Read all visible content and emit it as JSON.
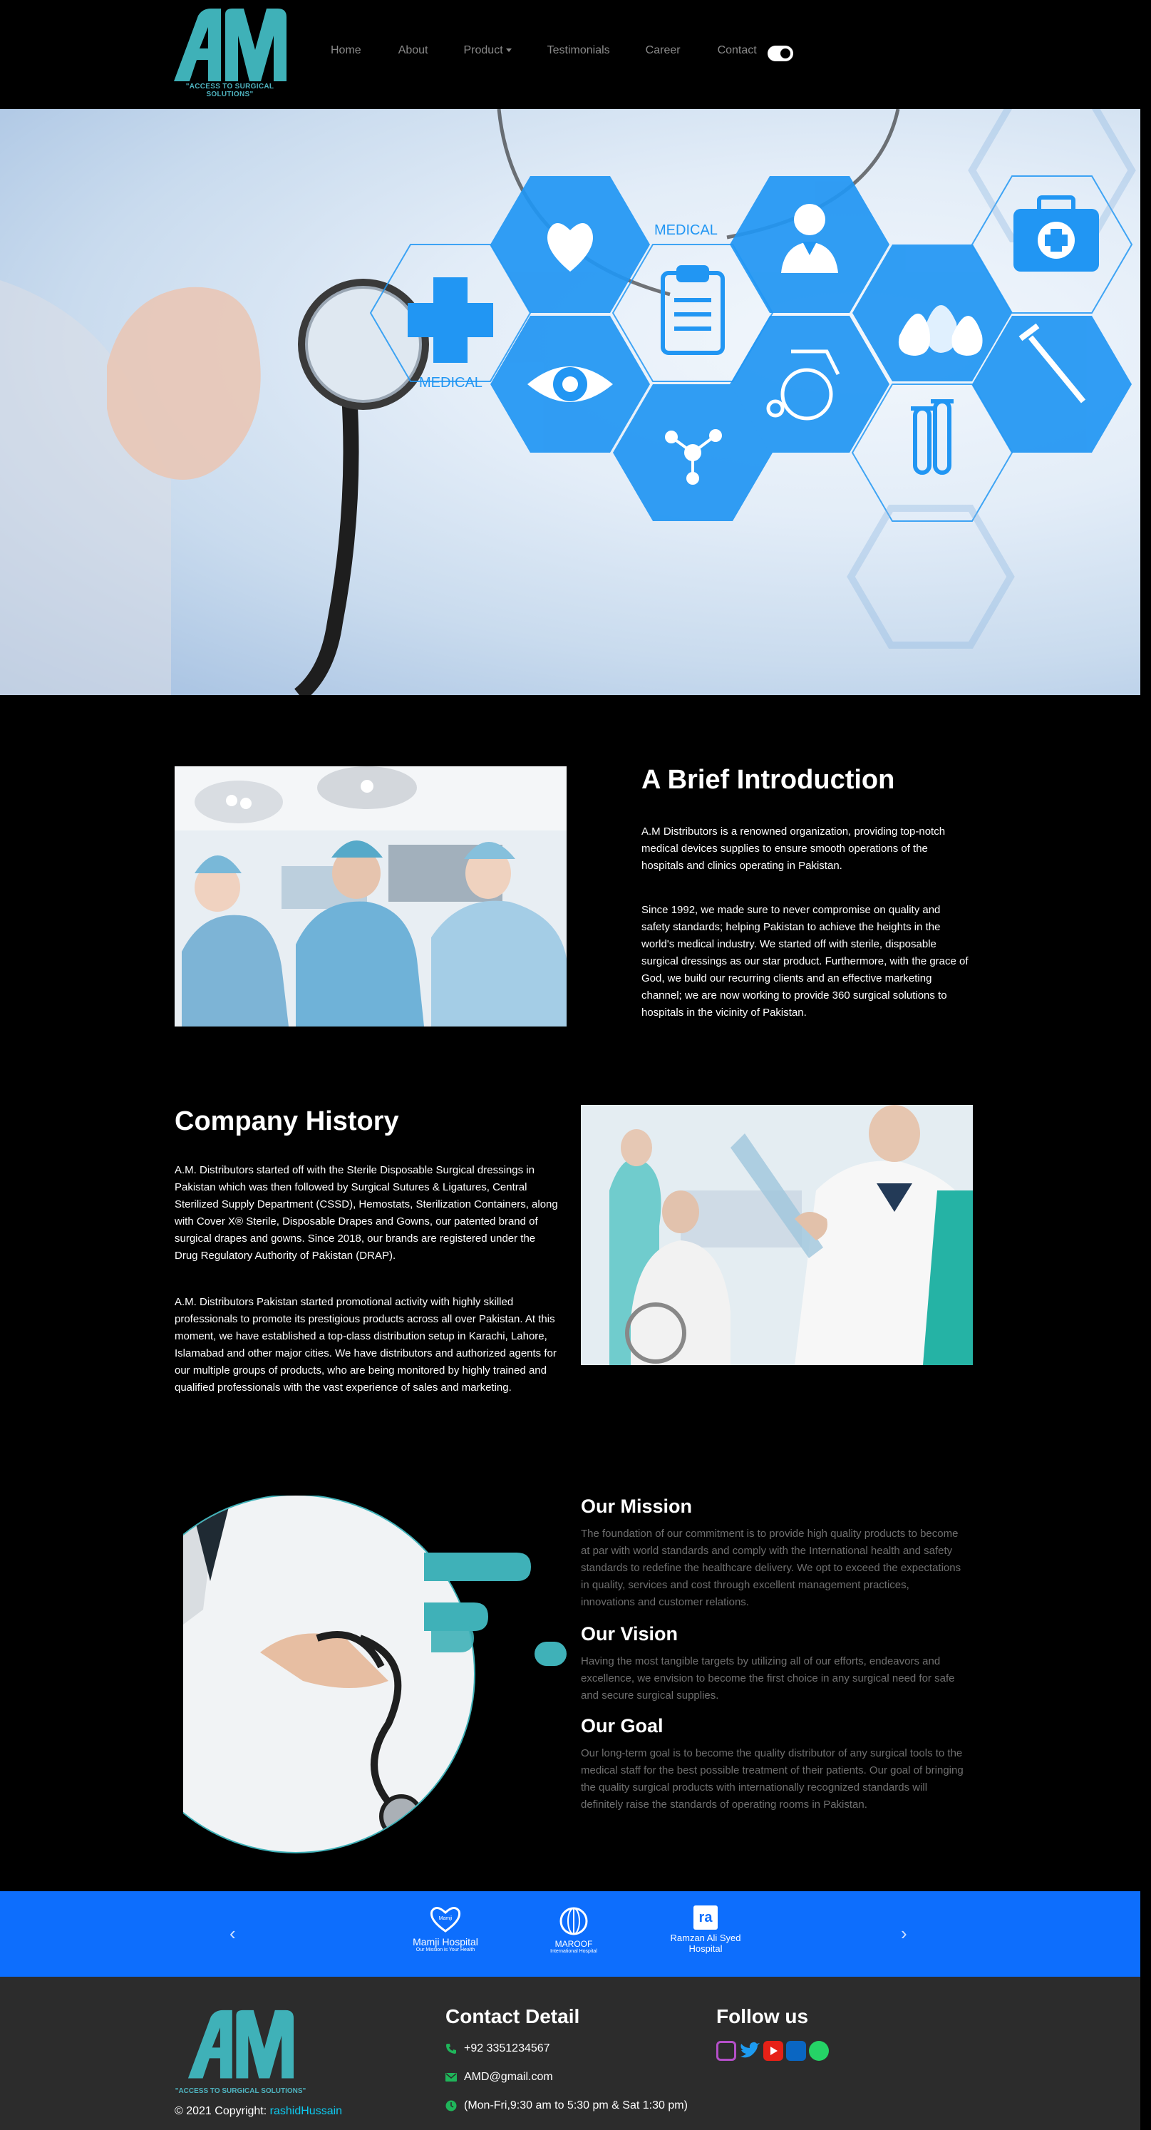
{
  "nav": {
    "logo_tagline": "\"ACCESS TO SURGICAL SOLUTIONS\"",
    "items": [
      "Home",
      "About",
      "Product",
      "Testimonials",
      "Career",
      "Contact"
    ]
  },
  "hero": {
    "label_1": "MEDICAL",
    "label_2": "MEDICAL"
  },
  "intro": {
    "title": "A Brief Introduction",
    "p1": "A.M Distributors is a renowned organization, providing top-notch medical devices supplies to ensure smooth operations of the hospitals and clinics operating in Pakistan.",
    "p2": "Since 1992, we made sure to never compromise on quality and safety standards; helping Pakistan to achieve the heights in the world's medical industry. We started off with sterile, disposable surgical dressings as our star product. Furthermore, with the grace of God, we build our recurring clients and an effective marketing channel; we are now working to provide 360 surgical solutions to hospitals in the vicinity of Pakistan."
  },
  "history": {
    "title": "Company History",
    "p1": "A.M. Distributors started off with the Sterile Disposable Surgical dressings in Pakistan which was then followed by Surgical Sutures & Ligatures, Central Sterilized Supply Department (CSSD), Hemostats, Sterilization Containers, along with Cover X® Sterile, Disposable Drapes and Gowns, our patented brand of surgical drapes and gowns. Since 2018, our brands are registered under the Drug Regulatory Authority of Pakistan (DRAP).",
    "p2": "A.M. Distributors Pakistan started promotional activity with highly skilled professionals to promote its prestigious products across all over Pakistan. At this moment, we have established a top-class distribution setup in Karachi, Lahore, Islamabad and other major cities. We have distributors and authorized agents for our multiple groups of products, who are being monitored by highly trained and qualified professionals with the vast experience of sales and marketing."
  },
  "mission": {
    "title": "Our Mission",
    "text": "The foundation of our commitment is to provide high quality products to become at par with world standards and comply with the International health and safety standards to redefine the healthcare delivery. We opt to exceed the expectations in quality, services and cost through excellent management practices, innovations and customer relations."
  },
  "vision": {
    "title": "Our Vision",
    "text": "Having the most tangible targets by utilizing all of our efforts, endeavors and excellence, we envision to become the first choice in any surgical need for safe and secure surgical supplies."
  },
  "goal": {
    "title": "Our Goal",
    "text": "Our long-term goal is to become the quality distributor of any surgical tools to the medical staff for the best possible treatment of their patients. Our goal of bringing the quality surgical products with internationally recognized standards will definitely raise the standards of operating rooms in Pakistan."
  },
  "carousel": {
    "prev": "‹",
    "next": "›",
    "hospitals": [
      {
        "name": "Mamji Hospital",
        "sub": "Our Mission is Your Health",
        "badge": "Mamji"
      },
      {
        "name": "MAROOF",
        "sub": "International Hospital"
      },
      {
        "name": "Ramzan Ali Syed Hospital",
        "badge": "ra"
      }
    ]
  },
  "footer": {
    "logo_tagline": "\"ACCESS TO SURGICAL SOLUTIONS\"",
    "copyright": "© 2021 Copyright:",
    "copyright_link": "rashidHussain",
    "contact_title": "Contact Detail",
    "phone": "+92 3351234567",
    "email": "AMD@gmail.com",
    "hours": "(Mon-Fri,9:30 am to 5:30 pm & Sat 1:30 pm)",
    "follow_title": "Follow us",
    "social": [
      "instagram-icon",
      "twitter-icon",
      "youtube-icon",
      "linkedin-icon",
      "whatsapp-icon"
    ]
  },
  "colors": {
    "carousel_bg": "#0d6efd",
    "footer_bg": "#2c2c2c",
    "accent_teal": "#3fb1b8",
    "hero_blue": "#2196f3"
  }
}
